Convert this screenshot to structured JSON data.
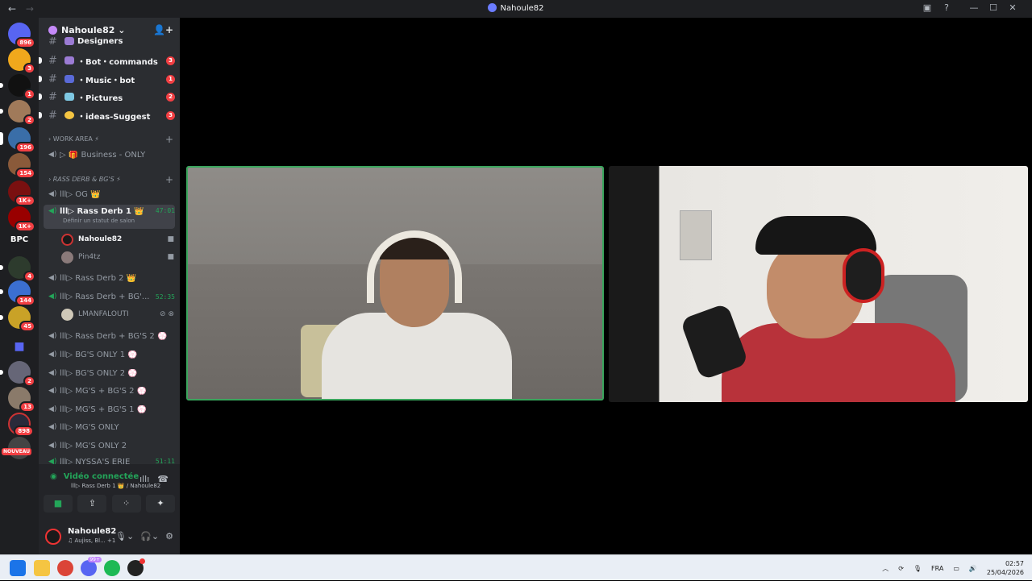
{
  "window": {
    "title": "Nahoule82"
  },
  "servers": {
    "badges": [
      "896",
      "3",
      "1",
      "2",
      "196",
      "154",
      "1K+",
      "1K+",
      "",
      "4",
      "144",
      "45",
      "",
      "2",
      "13",
      "898"
    ],
    "bpc_label": "BPC",
    "new_label": "NOUVEAU"
  },
  "guild": {
    "name": "Nahoule82"
  },
  "channels": [
    {
      "name": "Designers",
      "count": ""
    },
    {
      "name": "・Bot・commands",
      "count": "3"
    },
    {
      "name": "・Music・bot",
      "count": "1"
    },
    {
      "name": "・Pictures",
      "count": "2"
    },
    {
      "name": "・ideas-Suggest",
      "count": "3"
    }
  ],
  "categories": {
    "work_area": "WORK AREA ⚡",
    "rass_derb": "RASS DERB & BG'S ⚡"
  },
  "voice_channels": {
    "business": "▷ 🎁 Business - ONLY",
    "og": "lll▷ OG 👑",
    "rass_derb_1": "lll▷ Rass Derb 1 👑",
    "rass_derb_1_timer": "47:01",
    "rass_derb_1_status": "Définir un statut de salon",
    "members_1": [
      "Nahoule82",
      "Pin4tz"
    ],
    "rass_derb_2": "lll▷ Rass Derb 2 👑",
    "rass_derb_bg": "lll▷ Rass Derb + BG'...",
    "rass_derb_bg_timer": "52:35",
    "members_bg": [
      "LMANFALOUTI"
    ],
    "others": [
      "lll▷ Rass Derb + BG'S 2 💮",
      "lll▷ BG'S ONLY 1 💮",
      "lll▷ BG'S ONLY 2 💮",
      "lll▷ MG'S + BG'S 2 💮",
      "lll▷ MG'S + BG'S 1 💮",
      "lll▷ MG'S ONLY",
      "lll▷ MG'S ONLY 2"
    ],
    "partial": "lll▷ NYSSA'S ERIE",
    "partial_timer": "51:11"
  },
  "voice_panel": {
    "status": "Vidéo connectée",
    "sub": "lll▷ Rass Derb 1 👑 / Nahoule82"
  },
  "user": {
    "name": "Nahoule82",
    "status": "♫ Aujiss, Bl...",
    "extra": "+1"
  },
  "taskbar": {
    "lang": "FRA",
    "time": "02:57",
    "date": "25/04/2026",
    "discord_badge": "99+"
  }
}
